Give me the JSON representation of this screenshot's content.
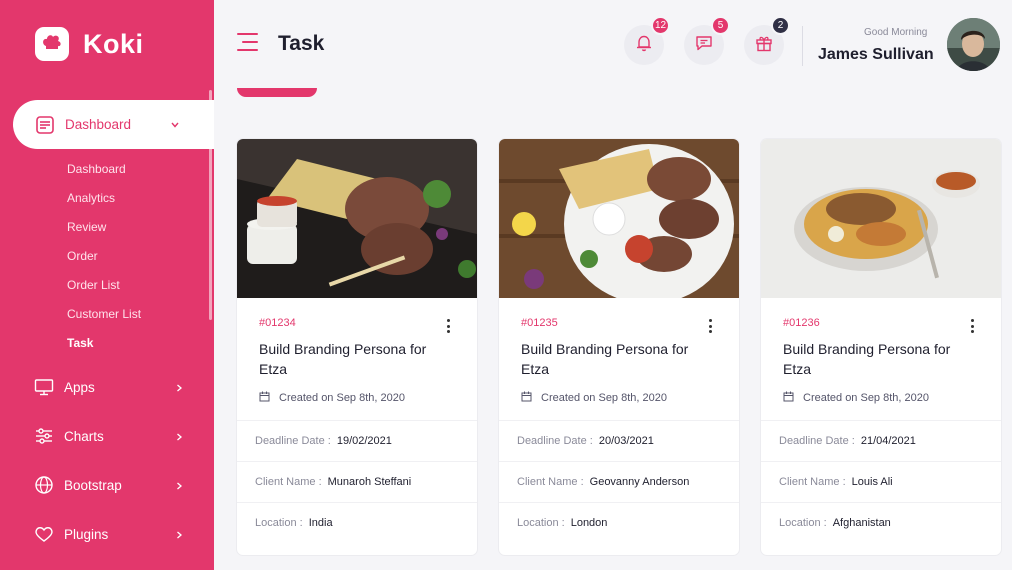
{
  "brand": {
    "name": "Koki"
  },
  "sidebar": {
    "active_group": "Dashboard",
    "submenu": [
      "Dashboard",
      "Analytics",
      "Review",
      "Order",
      "Order List",
      "Customer List",
      "Task"
    ],
    "groups": [
      {
        "label": "Apps",
        "icon": "monitor-icon"
      },
      {
        "label": "Charts",
        "icon": "sliders-icon"
      },
      {
        "label": "Bootstrap",
        "icon": "globe-icon"
      },
      {
        "label": "Plugins",
        "icon": "heart-icon"
      }
    ]
  },
  "header": {
    "title": "Task",
    "notifications": {
      "icon": "bell-icon",
      "count": "12"
    },
    "messages": {
      "icon": "chat-icon",
      "count": "5"
    },
    "gifts": {
      "icon": "gift-icon",
      "count": "2"
    },
    "greeting": "Good Morning",
    "user_name": "James Sullivan"
  },
  "cards": [
    {
      "id": "#01234",
      "title": "Build Branding Persona for Etza",
      "created": "Created on Sep 8th, 2020",
      "deadline_label": "Deadline Date :",
      "deadline": "19/02/2021",
      "client_label": "Client Name :",
      "client": "Munaroh Steffani",
      "location_label": "Location :",
      "location": "India"
    },
    {
      "id": "#01235",
      "title": "Build Branding Persona for Etza",
      "created": "Created on Sep 8th, 2020",
      "deadline_label": "Deadline Date :",
      "deadline": "20/03/2021",
      "client_label": "Client Name :",
      "client": "Geovanny Anderson",
      "location_label": "Location :",
      "location": "London"
    },
    {
      "id": "#01236",
      "title": "Build Branding Persona for Etza",
      "created": "Created on Sep 8th, 2020",
      "deadline_label": "Deadline Date :",
      "deadline": "21/04/2021",
      "client_label": "Client Name :",
      "client": "Louis Ali",
      "location_label": "Location :",
      "location": "Afghanistan"
    }
  ],
  "colors": {
    "accent": "#e3376c",
    "background": "#f5f5f8"
  }
}
